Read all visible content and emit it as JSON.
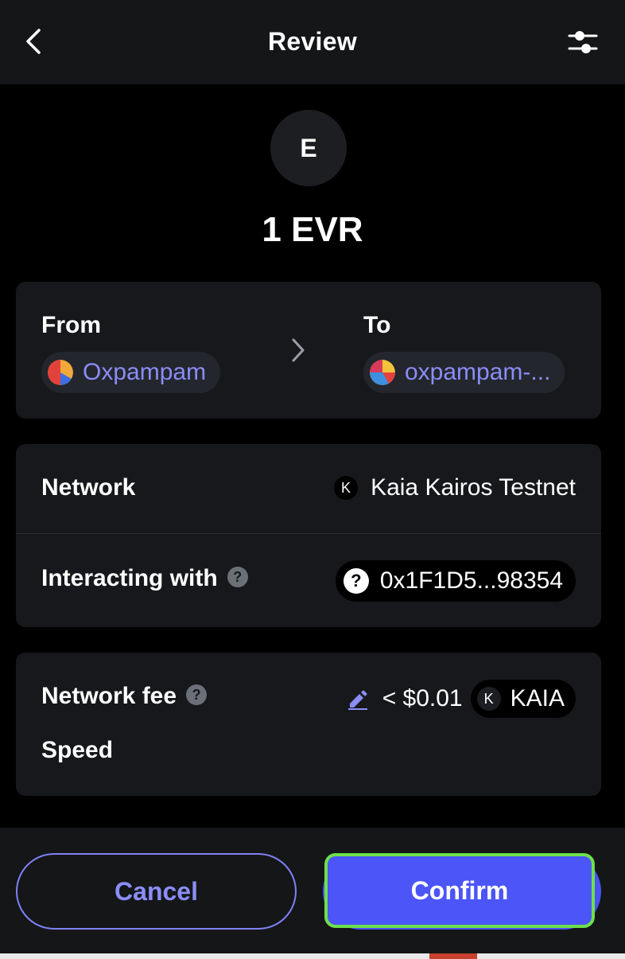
{
  "header": {
    "title": "Review",
    "back_icon": "chevron-left-icon",
    "settings_icon": "sliders-icon"
  },
  "token": {
    "avatar_letter": "E",
    "amount": "1 EVR"
  },
  "transfer": {
    "from_label": "From",
    "from_account": "Oxpampam",
    "to_label": "To",
    "to_account": "oxpampam-..."
  },
  "details": {
    "network_label": "Network",
    "network_badge": "K",
    "network_value": "Kaia Kairos Testnet",
    "interacting_label": "Interacting with",
    "help_glyph": "?",
    "contract_glyph": "?",
    "contract_address": "0x1F1D5...98354"
  },
  "fee": {
    "label": "Network fee",
    "help_glyph": "?",
    "amount": "< $0.01",
    "token_badge": "K",
    "token": "KAIA",
    "speed_label": "Speed"
  },
  "actions": {
    "cancel_label": "Cancel",
    "confirm_label": "Confirm"
  },
  "colors": {
    "accent": "#4B55F8",
    "accent_text": "#8B8DF8",
    "focus_outline": "#6EE04A",
    "card_bg": "#16181B",
    "header_bg": "#141618"
  }
}
